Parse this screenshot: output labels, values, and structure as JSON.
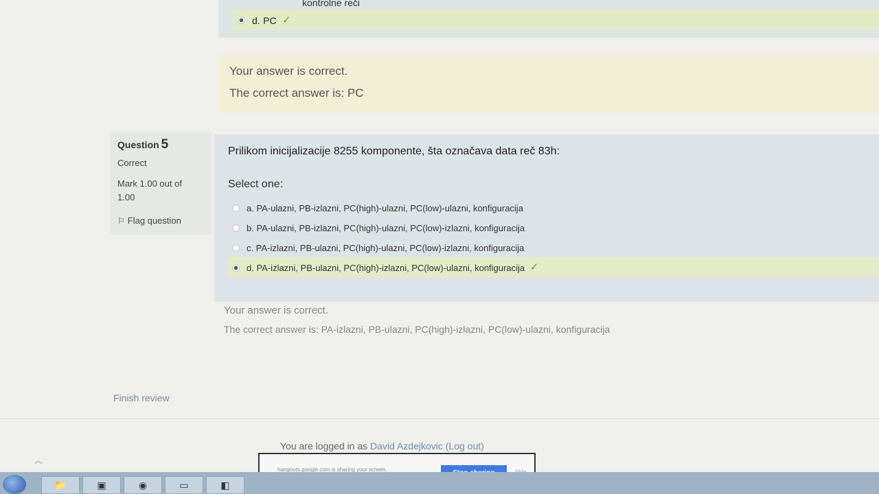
{
  "previous_question": {
    "tail_text": "kontrolne reči",
    "selected_option": {
      "letter": "d.",
      "text": "PC",
      "correct": true
    },
    "feedback": {
      "status": "Your answer is correct.",
      "correct_answer": "The correct answer is: PC"
    }
  },
  "question": {
    "title_label": "Question",
    "number": "5",
    "state": "Correct",
    "mark": "Mark 1.00 out of 1.00",
    "flag_label": "Flag question",
    "text": "Prilikom inicijalizacije 8255 komponente, šta označava data reč 83h:",
    "prompt": "Select one:",
    "options": [
      {
        "letter": "a.",
        "text": "PA-ulazni, PB-izlazni, PC(high)-ulazni, PC(low)-ulazni, konfiguracija",
        "selected": false
      },
      {
        "letter": "b.",
        "text": "PA-ulazni, PB-izlazni, PC(high)-ulazni, PC(low)-izlazni, konfiguracija",
        "selected": false
      },
      {
        "letter": "c.",
        "text": "PA-izlazni, PB-ulazni, PC(high)-ulazni, PC(low)-izlazni, konfiguracija",
        "selected": false
      },
      {
        "letter": "d.",
        "text": "PA-izlazni, PB-ulazni, PC(high)-izlazni, PC(low)-ulazni, konfiguracija",
        "selected": true
      }
    ],
    "feedback": {
      "status": "Your answer is correct.",
      "correct_answer": "The correct answer is: PA-izlazni, PB-ulazni, PC(high)-izlazni, PC(low)-ulazni, konfiguracija"
    }
  },
  "finish_review_label": "Finish review",
  "footer": {
    "logged_in_prefix": "You are logged in as",
    "user_name": "David Azdejkovic",
    "logout_label": "(Log out)"
  },
  "sharing_bar": {
    "message": "hangouts.google.com is sharing your screen.",
    "stop_label": "Stop sharing",
    "hide_label": "Hide"
  },
  "colors": {
    "correct_check": "#6a9d2a",
    "question_bg": "#dde4e7",
    "feedback_bg": "#f3eed6",
    "stop_button": "#3f7ae0"
  }
}
